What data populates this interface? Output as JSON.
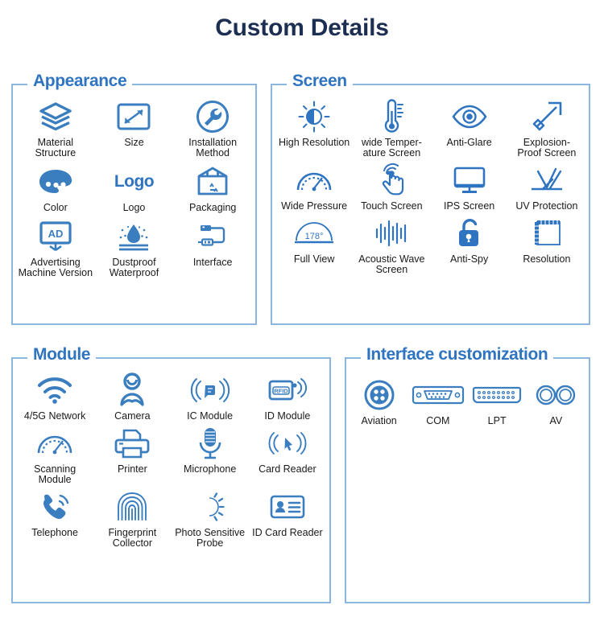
{
  "page": {
    "title": "Custom Details",
    "accent_blue": "#2f74c0",
    "icon_blue": "#3a7ebf",
    "border_blue": "#8ab6e0",
    "title_color": "#1c2f52",
    "label_color": "#1a1a1a",
    "background": "#ffffff"
  },
  "sections": {
    "appearance": {
      "title": "Appearance",
      "items": [
        {
          "label": "Material Structure",
          "icon": "layers-icon"
        },
        {
          "label": "Size",
          "icon": "size-arrow-icon"
        },
        {
          "label": "Installation Method",
          "icon": "wrench-circle-icon"
        },
        {
          "label": "Color",
          "icon": "palette-icon"
        },
        {
          "label": "Logo",
          "icon": "logo-text-icon",
          "icon_text": "Logo"
        },
        {
          "label": "Packaging",
          "icon": "package-box-icon"
        },
        {
          "label": "Advertising Machine Version",
          "icon": "ad-board-icon",
          "icon_text": "AD"
        },
        {
          "label": "Dustproof Waterproof",
          "icon": "waterdrop-dust-icon"
        },
        {
          "label": "Interface",
          "icon": "usb-cable-icon"
        }
      ]
    },
    "screen": {
      "title": "Screen",
      "items": [
        {
          "label": "High Resolution",
          "icon": "brightness-icon"
        },
        {
          "label": "wide Temper-ature Screen",
          "icon": "thermometer-icon"
        },
        {
          "label": "Anti-Glare",
          "icon": "eye-icon"
        },
        {
          "label": "Explosion-Proof Screen",
          "icon": "hammer-icon"
        },
        {
          "label": "Wide Pressure",
          "icon": "gauge-icon"
        },
        {
          "label": "Touch Screen",
          "icon": "touch-hand-icon"
        },
        {
          "label": "IPS Screen",
          "icon": "monitor-icon"
        },
        {
          "label": "UV Protection",
          "icon": "uv-rays-icon"
        },
        {
          "label": "Full View",
          "icon": "viewing-angle-icon",
          "icon_text": "178°"
        },
        {
          "label": "Acoustic Wave Screen",
          "icon": "sound-wave-icon"
        },
        {
          "label": "Anti-Spy",
          "icon": "unlock-icon"
        },
        {
          "label": "Resolution",
          "icon": "ruler-grid-icon"
        }
      ]
    },
    "module": {
      "title": "Module",
      "items": [
        {
          "label": "4/5G Network",
          "icon": "wifi-icon"
        },
        {
          "label": "Camera",
          "icon": "camera-person-icon"
        },
        {
          "label": "IC Module",
          "icon": "ic-contactless-icon"
        },
        {
          "label": "ID Module",
          "icon": "rfid-card-icon",
          "icon_text": "RFID"
        },
        {
          "label": "Scanning Module",
          "icon": "gauge-scan-icon"
        },
        {
          "label": "Printer",
          "icon": "printer-icon"
        },
        {
          "label": "Microphone",
          "icon": "microphone-icon"
        },
        {
          "label": "Card Reader",
          "icon": "card-reader-wave-icon"
        },
        {
          "label": "Telephone",
          "icon": "telephone-icon"
        },
        {
          "label": "Fingerprint Collector",
          "icon": "fingerprint-icon"
        },
        {
          "label": "Photo Sensitive Probe",
          "icon": "photo-sensor-icon"
        },
        {
          "label": "ID Card Reader",
          "icon": "id-card-icon"
        }
      ]
    },
    "interface": {
      "title": "Interface customization",
      "items": [
        {
          "label": "Aviation",
          "icon": "aviation-connector-icon"
        },
        {
          "label": "COM",
          "icon": "com-port-icon"
        },
        {
          "label": "LPT",
          "icon": "lpt-port-icon"
        },
        {
          "label": "AV",
          "icon": "av-jack-icon"
        }
      ]
    }
  }
}
